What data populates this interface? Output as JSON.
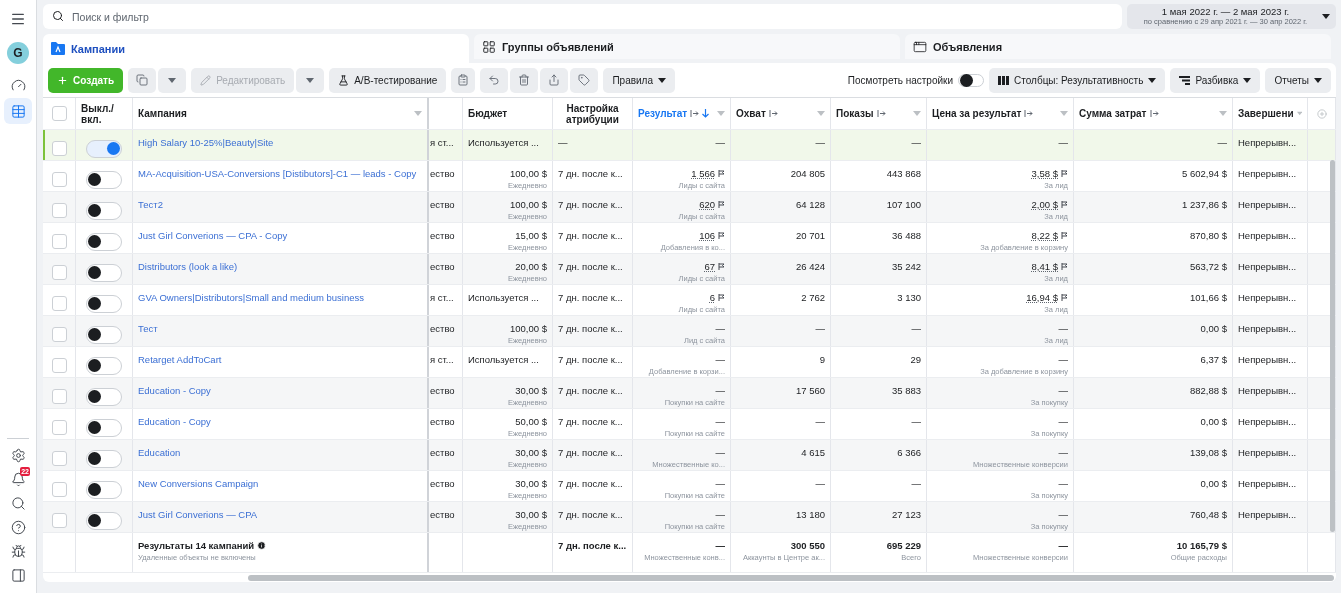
{
  "sidebar": {
    "avatar": "G",
    "items": [
      {
        "kind": "gauge",
        "selected": false
      },
      {
        "kind": "table",
        "selected": true
      }
    ],
    "bottom_items": [
      {
        "kind": "settings"
      },
      {
        "kind": "bell",
        "badge": "22"
      },
      {
        "kind": "search"
      },
      {
        "kind": "help"
      },
      {
        "kind": "bug"
      },
      {
        "kind": "panel"
      }
    ]
  },
  "search": {
    "placeholder": "Поиск и фильтр"
  },
  "date_range": {
    "main": "1 мая 2022 г. — 2 мая 2023 г.",
    "comparison": "по сравнению с 29 апр 2021 г. — 30 апр 2022 г."
  },
  "tabs": [
    {
      "kind": "campaigns",
      "label": "Кампании",
      "selected": true
    },
    {
      "kind": "ad_sets",
      "label": "Группы объявлений",
      "selected": false
    },
    {
      "kind": "ads",
      "label": "Объявления",
      "selected": false
    }
  ],
  "toolbar": {
    "create": "Создать",
    "edit": {
      "label": "Редактировать",
      "disabled": true
    },
    "ab_test": "A/B-тестирование",
    "rules": "Правила",
    "view_settings": {
      "label": "Посмотреть настройки",
      "on": false
    },
    "columns": "Столбцы: Результативность",
    "breakdown": "Разбивка",
    "reports": "Отчеты"
  },
  "table": {
    "select_all_checked": false,
    "columns": [
      {
        "label": "Выкл./вкл.",
        "sorted": false
      },
      {
        "label": "Кампания",
        "sorted": false
      },
      {
        "label": "Бюджет",
        "sorted": false
      },
      {
        "label": "Настройка атрибуции",
        "sorted": false
      },
      {
        "label": "Результат",
        "sorted": true
      },
      {
        "label": "Охват",
        "sorted": false
      },
      {
        "label": "Показы",
        "sorted": false
      },
      {
        "label": "Цена за результат",
        "sorted": false
      },
      {
        "label": "Сумма затрат",
        "sorted": false
      },
      {
        "label": "Завершени",
        "sorted": false
      }
    ],
    "rows": [
      {
        "checked": false,
        "on": true,
        "name": "High Salary 10-25%|Beauty|Site",
        "column_1": "я ст...",
        "budget": "Используется ...",
        "attribution": "—",
        "result": "—",
        "estimated": false,
        "reach": "—",
        "impressions": "—",
        "cost": "—",
        "spent": "—",
        "ending": "Непрерывн..."
      },
      {
        "checked": false,
        "on": false,
        "name": "MA-Acquisition-USA-Conversions [Distibutors]-C1 — leads - Copy",
        "column_1": "ество",
        "budget": "100,00 $",
        "budget_period": "Ежедневно",
        "attribution": "7 дн. после к...",
        "result": "1 566",
        "result_type": "Лиды с сайта",
        "estimated": true,
        "reach": "204 805",
        "impressions": "443 868",
        "cost": "3,58 $",
        "cost_type": "За лид",
        "spent": "5 602,94 $",
        "ending": "Непрерывн..."
      },
      {
        "checked": false,
        "on": false,
        "name": "Тест2",
        "column_1": "ество",
        "budget": "100,00 $",
        "budget_period": "Ежедневно",
        "attribution": "7 дн. после к...",
        "result": "620",
        "result_type": "Лиды с сайта",
        "estimated": true,
        "reach": "64 128",
        "impressions": "107 100",
        "cost": "2,00 $",
        "cost_type": "За лид",
        "spent": "1 237,86 $",
        "ending": "Непрерывн..."
      },
      {
        "checked": false,
        "on": false,
        "name": "Just Girl Converions — CPA - Copy",
        "column_1": "ество",
        "budget": "15,00 $",
        "budget_period": "Ежедневно",
        "attribution": "7 дн. после к...",
        "result": "106",
        "result_type": "Добавления в ко...",
        "estimated": true,
        "reach": "20 701",
        "impressions": "36 488",
        "cost": "8,22 $",
        "cost_type": "За добавление в корзину",
        "spent": "870,80 $",
        "ending": "Непрерывн..."
      },
      {
        "checked": false,
        "on": false,
        "name": "Distributors (look a like)",
        "column_1": "ество",
        "budget": "20,00 $",
        "budget_period": "Ежедневно",
        "attribution": "7 дн. после к...",
        "result": "67",
        "result_type": "Лиды с сайта",
        "estimated": true,
        "reach": "26 424",
        "impressions": "35 242",
        "cost": "8,41 $",
        "cost_type": "За лид",
        "spent": "563,72 $",
        "ending": "Непрерывн..."
      },
      {
        "checked": false,
        "on": false,
        "name": "GVA Owners|Distributors|Small and medium business",
        "column_1": "я ст...",
        "budget": "Используется ...",
        "attribution": "7 дн. после к...",
        "result": "6",
        "result_type": "Лиды с сайта",
        "estimated": true,
        "reach": "2 762",
        "impressions": "3 130",
        "cost": "16,94 $",
        "cost_type": "За лид",
        "spent": "101,66 $",
        "ending": "Непрерывн..."
      },
      {
        "checked": false,
        "on": false,
        "name": "Тест",
        "column_1": "ество",
        "budget": "100,00 $",
        "budget_period": "Ежедневно",
        "attribution": "7 дн. после к...",
        "result": "—",
        "result_type": "Лид с сайта",
        "estimated": false,
        "reach": "—",
        "impressions": "—",
        "cost": "—",
        "cost_type": "За лид",
        "spent": "0,00 $",
        "ending": "Непрерывн..."
      },
      {
        "checked": false,
        "on": false,
        "name": "Retarget AddToCart",
        "column_1": "я ст...",
        "budget": "Используется ...",
        "attribution": "7 дн. после к...",
        "result": "—",
        "result_type": "Добавление в корзи...",
        "estimated": false,
        "reach": "9",
        "impressions": "29",
        "cost": "—",
        "cost_type": "За добавление в корзину",
        "spent": "6,37 $",
        "ending": "Непрерывн..."
      },
      {
        "checked": false,
        "on": false,
        "name": "Education - Copy",
        "column_1": "ество",
        "budget": "30,00 $",
        "budget_period": "Ежедневно",
        "attribution": "7 дн. после к...",
        "result": "—",
        "result_type": "Покупки на сайте",
        "estimated": false,
        "reach": "17 560",
        "impressions": "35 883",
        "cost": "—",
        "cost_type": "За покупку",
        "spent": "882,88 $",
        "ending": "Непрерывн..."
      },
      {
        "checked": false,
        "on": false,
        "name": "Education - Copy",
        "column_1": "ество",
        "budget": "50,00 $",
        "budget_period": "Ежедневно",
        "attribution": "7 дн. после к...",
        "result": "—",
        "result_type": "Покупки на сайте",
        "estimated": false,
        "reach": "—",
        "impressions": "—",
        "cost": "—",
        "cost_type": "За покупку",
        "spent": "0,00 $",
        "ending": "Непрерывн..."
      },
      {
        "checked": false,
        "on": false,
        "name": "Education",
        "column_1": "ество",
        "budget": "30,00 $",
        "budget_period": "Ежедневно",
        "attribution": "7 дн. после к...",
        "result": "—",
        "result_type": "Множественные ко...",
        "estimated": false,
        "reach": "4 615",
        "impressions": "6 366",
        "cost": "—",
        "cost_type": "Множественные конверсии",
        "spent": "139,08 $",
        "ending": "Непрерывн..."
      },
      {
        "checked": false,
        "on": false,
        "name": "New Conversions Campaign",
        "column_1": "ество",
        "budget": "30,00 $",
        "budget_period": "Ежедневно",
        "attribution": "7 дн. после к...",
        "result": "—",
        "result_type": "Покупки на сайте",
        "estimated": false,
        "reach": "—",
        "impressions": "—",
        "cost": "—",
        "cost_type": "За покупку",
        "spent": "0,00 $",
        "ending": "Непрерывн..."
      },
      {
        "checked": false,
        "on": false,
        "name": "Just Girl Converions — CPA",
        "column_1": "ество",
        "budget": "30,00 $",
        "budget_period": "Ежедневно",
        "attribution": "7 дн. после к...",
        "result": "—",
        "result_type": "Покупки на сайте",
        "estimated": false,
        "reach": "13 180",
        "impressions": "27 123",
        "cost": "—",
        "cost_type": "За покупку",
        "spent": "760,48 $",
        "ending": "Непрерывн..."
      }
    ],
    "totals": {
      "title": "Результаты 14 кампаний",
      "note": "Удаленные объекты не включены",
      "attribution": "7 дн. после к...",
      "result": "—",
      "result_type": "Множественные конв...",
      "reach": "300 550",
      "reach_type": "Аккаунты в Центре ак...",
      "impressions": "695 229",
      "impressions_type": "Всего",
      "cost": "—",
      "cost_type": "Множественные конверсии",
      "spent": "10 165,79 $",
      "spent_type": "Общие расходы"
    }
  }
}
